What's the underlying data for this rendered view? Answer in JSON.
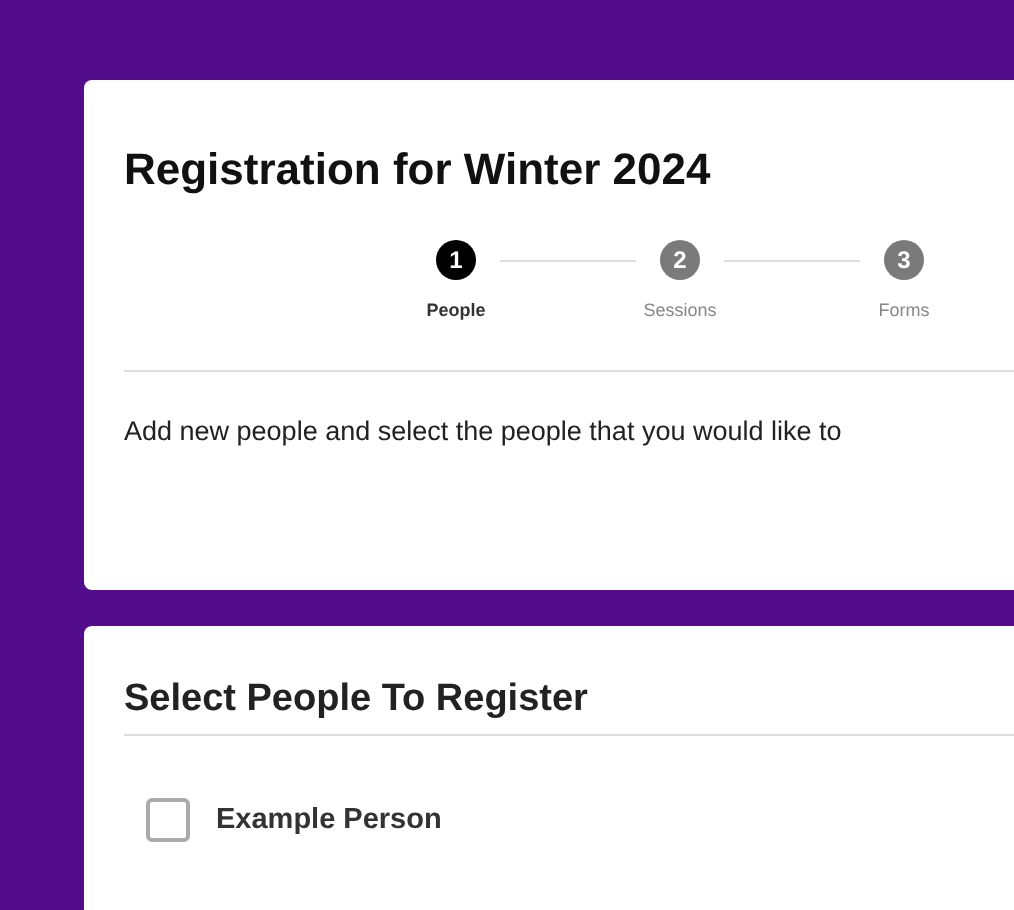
{
  "header_card": {
    "title": "Registration for Winter 2024",
    "steps": [
      {
        "number": "1",
        "label": "People",
        "selected": true
      },
      {
        "number": "2",
        "label": "Sessions",
        "selected": false
      },
      {
        "number": "3",
        "label": "Forms",
        "selected": false
      }
    ],
    "instructions": "Add new people and select the people that you would like to"
  },
  "people_card": {
    "title": "Select People To Register",
    "people": [
      {
        "name": "Example Person",
        "checked": false
      }
    ]
  }
}
